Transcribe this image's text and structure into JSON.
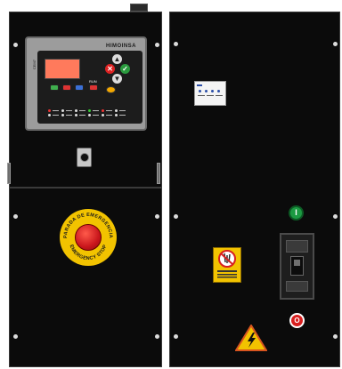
{
  "controller": {
    "brand": "HIMOINSA",
    "model_label": "CEM7",
    "mode_label": "RUN",
    "status_labels": [
      "",
      "",
      "",
      "",
      "",
      ""
    ]
  },
  "emergency_stop": {
    "ring_text_top": "PARADA DE EMERGENCIA",
    "ring_text_bottom": "EMERGENCY STOP"
  },
  "on_button": {
    "label": "I"
  },
  "off_button": {
    "label": "O"
  },
  "colors": {
    "cabinet": "#0b0b0b",
    "lcd": "#ff7a5c",
    "on_green": "#1c9a42",
    "off_red": "#d81f1f",
    "estop_yellow": "#f2c300",
    "estop_red": "#c9161c"
  },
  "icons": {
    "warning_sign": "electric-hazard-warning-icon",
    "prohibition_sign": "no-unauthorized-operation-icon"
  }
}
